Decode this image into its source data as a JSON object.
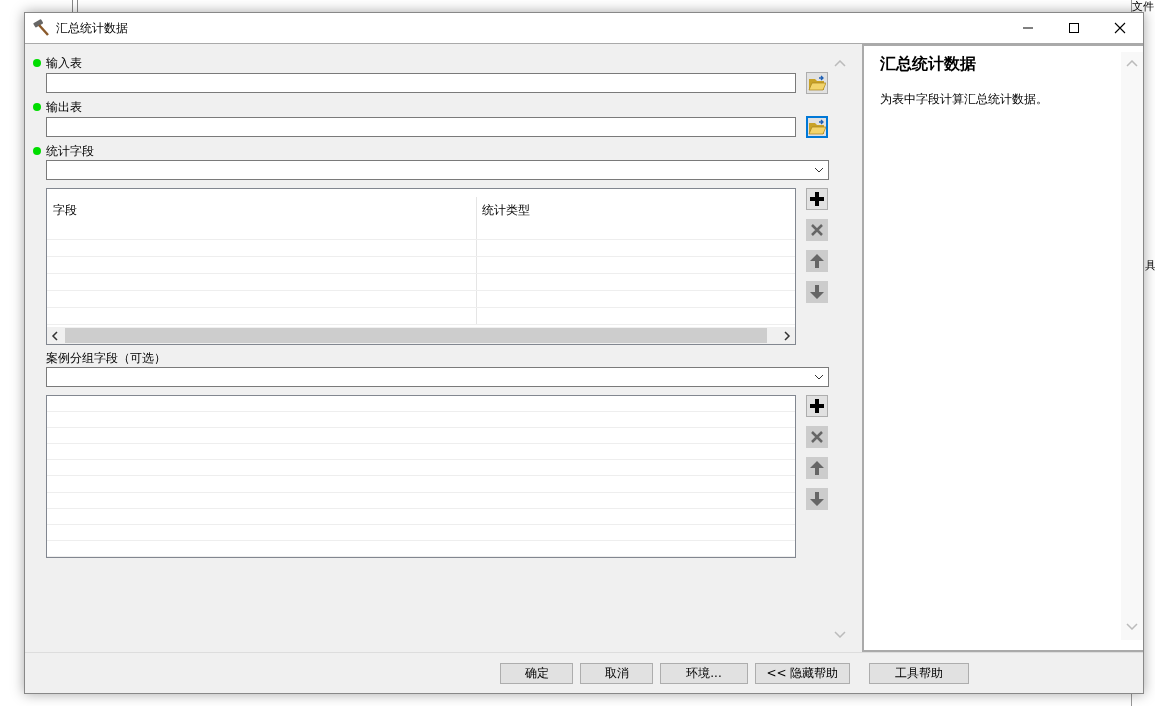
{
  "window": {
    "title": "汇总统计数据"
  },
  "parameters": [
    {
      "kind": "path",
      "label": "输入表",
      "required": true,
      "browse_focused": false
    },
    {
      "kind": "path",
      "label": "输出表",
      "required": true,
      "browse_focused": true
    },
    {
      "kind": "dropdown",
      "label": "统计字段",
      "required": true
    },
    {
      "kind": "grid",
      "columns": [
        "字段",
        "统计类型"
      ],
      "hscroll": true,
      "side_buttons": [
        {
          "kind": "add",
          "disabled": false
        },
        {
          "kind": "remove",
          "disabled": true
        },
        {
          "kind": "up",
          "disabled": true
        },
        {
          "kind": "down",
          "disabled": true
        }
      ]
    },
    {
      "kind": "dropdown",
      "label": "案例分组字段（可选）",
      "required": false
    },
    {
      "kind": "grid",
      "hscroll": false,
      "side_buttons": [
        {
          "kind": "add",
          "disabled": false
        },
        {
          "kind": "remove",
          "disabled": true
        },
        {
          "kind": "up",
          "disabled": true
        },
        {
          "kind": "down",
          "disabled": true
        }
      ]
    }
  ],
  "help": {
    "title": "汇总统计数据",
    "description": "为表中字段计算汇总统计数据。"
  },
  "buttons": [
    "确定",
    "取消",
    "环境...",
    "<< 隐藏帮助",
    "工具帮助"
  ],
  "background": {
    "items": [
      "文件",
      "具"
    ]
  }
}
